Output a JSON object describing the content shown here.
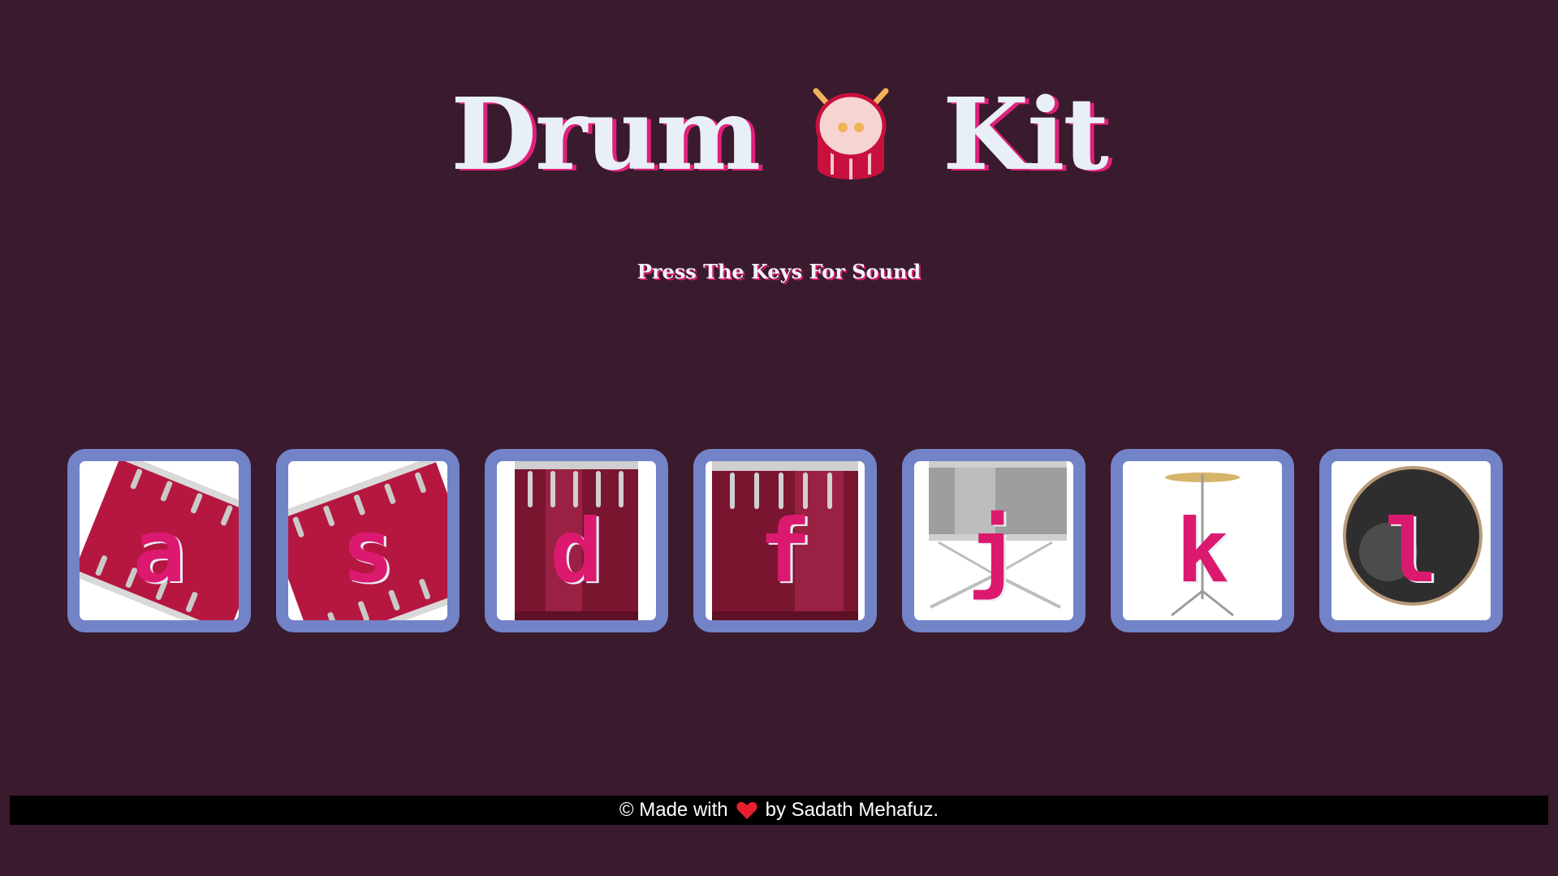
{
  "header": {
    "title_left": "Drum",
    "title_right": "Kit",
    "title_icon": "drum-with-sticks-icon"
  },
  "subtitle": "Press The Keys For Sound",
  "pads": [
    {
      "key": "a",
      "instrument": "tom-1",
      "art": "red-drum-tilted-right"
    },
    {
      "key": "s",
      "instrument": "tom-2",
      "art": "red-drum-tilted-left"
    },
    {
      "key": "d",
      "instrument": "tom-3",
      "art": "dark-red-drum"
    },
    {
      "key": "f",
      "instrument": "tom-4",
      "art": "dark-red-drum"
    },
    {
      "key": "j",
      "instrument": "snare",
      "art": "silver-snare-on-stand"
    },
    {
      "key": "k",
      "instrument": "crash",
      "art": "cymbal-on-stand"
    },
    {
      "key": "l",
      "instrument": "kick",
      "art": "black-bass-drum"
    }
  ],
  "footer": {
    "prefix": "© Made with",
    "icon": "heart-icon",
    "suffix": "by Sadath Mehafuz."
  },
  "colors": {
    "background": "#3a1a2d",
    "pad_border": "#7283c8",
    "accent": "#db1a6f",
    "title_text": "#e8eff7",
    "footer_bg": "#000000"
  }
}
